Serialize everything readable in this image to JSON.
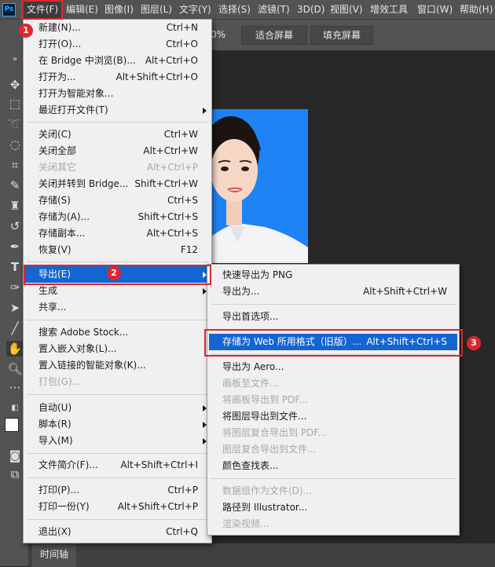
{
  "app": {
    "logo": "Ps"
  },
  "menubar": {
    "items": [
      "文件(F)",
      "编辑(E)",
      "图像(I)",
      "图层(L)",
      "文字(Y)",
      "选择(S)",
      "滤镜(T)",
      "3D(D)",
      "视图(V)",
      "增效工具",
      "窗口(W)",
      "帮助(H)"
    ]
  },
  "options": {
    "zoom": "0%",
    "fit_screen": "适合屏幕",
    "fill_screen": "填充屏幕"
  },
  "timeline": {
    "tab": "时间轴"
  },
  "file_menu": {
    "items": [
      {
        "label": "新建(N)...",
        "shortcut": "Ctrl+N"
      },
      {
        "label": "打开(O)...",
        "shortcut": "Ctrl+O"
      },
      {
        "label": "在 Bridge 中浏览(B)...",
        "shortcut": "Alt+Ctrl+O"
      },
      {
        "label": "打开为...",
        "shortcut": "Alt+Shift+Ctrl+O"
      },
      {
        "label": "打开为智能对象...",
        "shortcut": ""
      },
      {
        "label": "最近打开文件(T)",
        "shortcut": ""
      },
      {
        "label": "关闭(C)",
        "shortcut": "Ctrl+W"
      },
      {
        "label": "关闭全部",
        "shortcut": "Alt+Ctrl+W"
      },
      {
        "label": "关闭其它",
        "shortcut": "Alt+Ctrl+P"
      },
      {
        "label": "关闭并转到 Bridge...",
        "shortcut": "Shift+Ctrl+W"
      },
      {
        "label": "存储(S)",
        "shortcut": "Ctrl+S"
      },
      {
        "label": "存储为(A)...",
        "shortcut": "Shift+Ctrl+S"
      },
      {
        "label": "存储副本...",
        "shortcut": "Alt+Ctrl+S"
      },
      {
        "label": "恢复(V)",
        "shortcut": "F12"
      },
      {
        "label": "导出(E)",
        "shortcut": ""
      },
      {
        "label": "生成",
        "shortcut": ""
      },
      {
        "label": "共享...",
        "shortcut": ""
      },
      {
        "label": "搜索 Adobe Stock...",
        "shortcut": ""
      },
      {
        "label": "置入嵌入对象(L)...",
        "shortcut": ""
      },
      {
        "label": "置入链接的智能对象(K)...",
        "shortcut": ""
      },
      {
        "label": "打包(G)...",
        "shortcut": ""
      },
      {
        "label": "自动(U)",
        "shortcut": ""
      },
      {
        "label": "脚本(R)",
        "shortcut": ""
      },
      {
        "label": "导入(M)",
        "shortcut": ""
      },
      {
        "label": "文件简介(F)...",
        "shortcut": "Alt+Shift+Ctrl+I"
      },
      {
        "label": "打印(P)...",
        "shortcut": "Ctrl+P"
      },
      {
        "label": "打印一份(Y)",
        "shortcut": "Alt+Shift+Ctrl+P"
      },
      {
        "label": "退出(X)",
        "shortcut": "Ctrl+Q"
      }
    ]
  },
  "export_menu": {
    "items": [
      {
        "label": "快速导出为 PNG",
        "shortcut": ""
      },
      {
        "label": "导出为...",
        "shortcut": "Alt+Shift+Ctrl+W"
      },
      {
        "label": "导出首选项...",
        "shortcut": ""
      },
      {
        "label": "存储为 Web 所用格式（旧版）...",
        "shortcut": "Alt+Shift+Ctrl+S"
      },
      {
        "label": "导出为 Aero...",
        "shortcut": ""
      },
      {
        "label": "画板至文件...",
        "shortcut": ""
      },
      {
        "label": "将画板导出到 PDF...",
        "shortcut": ""
      },
      {
        "label": "将图层导出到文件...",
        "shortcut": ""
      },
      {
        "label": "将图层复合导出到 PDF...",
        "shortcut": ""
      },
      {
        "label": "图层复合导出到文件...",
        "shortcut": ""
      },
      {
        "label": "颜色查找表...",
        "shortcut": ""
      },
      {
        "label": "数据组作为文件(D)...",
        "shortcut": ""
      },
      {
        "label": "路径到 Illustrator...",
        "shortcut": ""
      },
      {
        "label": "渲染视频...",
        "shortcut": ""
      }
    ]
  },
  "annotations": {
    "m1": "1",
    "m2": "2",
    "m3": "3"
  },
  "colors": {
    "highlight": "#1464d2",
    "annotation": "#e0262d",
    "photo_bg": "#1e83f5"
  }
}
